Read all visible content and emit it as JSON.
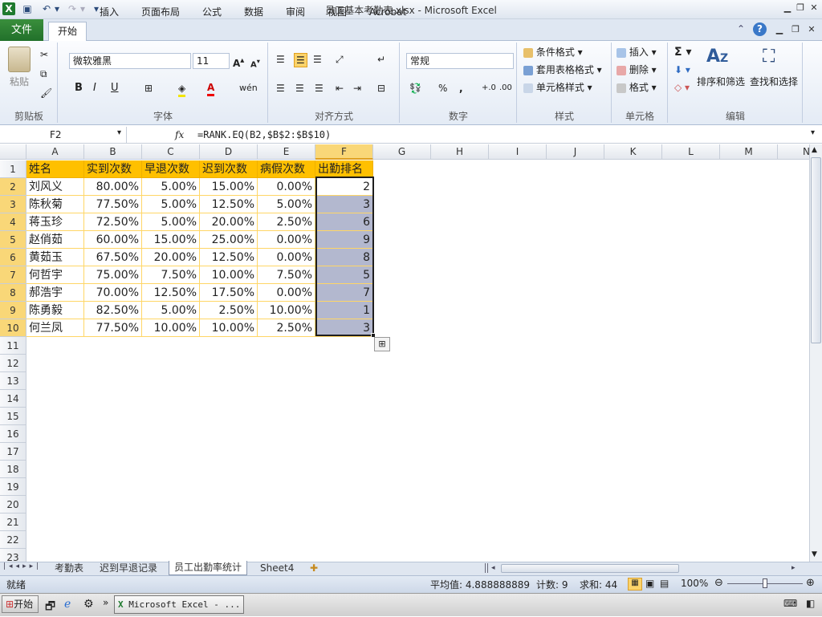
{
  "window": {
    "title": "员工基本考勤表.xlsx - Microsoft Excel"
  },
  "tabs": {
    "file": "文件",
    "items": [
      "开始",
      "插入",
      "页面布局",
      "公式",
      "数据",
      "审阅",
      "视图",
      "Acrobat"
    ],
    "active": "开始"
  },
  "ribbon": {
    "clipboard": {
      "label": "剪贴板",
      "paste": "粘贴"
    },
    "font": {
      "label": "字体",
      "name": "微软雅黑",
      "size": "11"
    },
    "alignment": {
      "label": "对齐方式"
    },
    "number": {
      "label": "数字",
      "format": "常规"
    },
    "styles": {
      "label": "样式",
      "cond": "条件格式",
      "table": "套用表格格式",
      "cell": "单元格样式"
    },
    "cells": {
      "label": "单元格",
      "insert": "插入",
      "delete": "删除",
      "format": "格式"
    },
    "editing": {
      "label": "编辑",
      "sort": "排序和筛选",
      "find": "查找和选择"
    }
  },
  "formula_bar": {
    "name_box": "F2",
    "fx": "fx",
    "formula": "=RANK.EQ(B2,$B$2:$B$10)"
  },
  "columns": [
    "A",
    "B",
    "C",
    "D",
    "E",
    "F",
    "G",
    "H",
    "I",
    "J",
    "K",
    "L",
    "M",
    "N"
  ],
  "rows": [
    "1",
    "2",
    "3",
    "4",
    "5",
    "6",
    "7",
    "8",
    "9",
    "10",
    "11",
    "12",
    "13",
    "14",
    "15",
    "16",
    "17",
    "18",
    "19",
    "20",
    "21",
    "22",
    "23"
  ],
  "table": {
    "headers": [
      "姓名",
      "实到次数",
      "早退次数",
      "迟到次数",
      "病假次数",
      "出勤排名"
    ],
    "data": [
      [
        "刘风义",
        "80.00%",
        "5.00%",
        "15.00%",
        "0.00%",
        "2"
      ],
      [
        "陈秋菊",
        "77.50%",
        "5.00%",
        "12.50%",
        "5.00%",
        "3"
      ],
      [
        "蒋玉珍",
        "72.50%",
        "5.00%",
        "20.00%",
        "2.50%",
        "6"
      ],
      [
        "赵俏茹",
        "60.00%",
        "15.00%",
        "25.00%",
        "0.00%",
        "9"
      ],
      [
        "黄茹玉",
        "67.50%",
        "20.00%",
        "12.50%",
        "0.00%",
        "8"
      ],
      [
        "何哲宇",
        "75.00%",
        "7.50%",
        "10.00%",
        "7.50%",
        "5"
      ],
      [
        "郝浩宇",
        "70.00%",
        "12.50%",
        "17.50%",
        "0.00%",
        "7"
      ],
      [
        "陈勇毅",
        "82.50%",
        "5.00%",
        "2.50%",
        "10.00%",
        "1"
      ],
      [
        "何兰凤",
        "77.50%",
        "10.00%",
        "10.00%",
        "2.50%",
        "3"
      ]
    ]
  },
  "sheets": [
    "考勤表",
    "迟到早退记录",
    "员工出勤率统计",
    "Sheet4"
  ],
  "active_sheet": "员工出勤率统计",
  "status": {
    "ready": "就绪",
    "average": "平均值: 4.888888889",
    "count": "计数: 9",
    "sum": "求和: 44",
    "zoom": "100%"
  },
  "taskbar": {
    "start": "开始",
    "app": "Microsoft Excel - ..."
  },
  "colors": {
    "header_fill": "#ffc000",
    "selection": "#b3b8cf",
    "file_tab": "#2a7a30"
  }
}
